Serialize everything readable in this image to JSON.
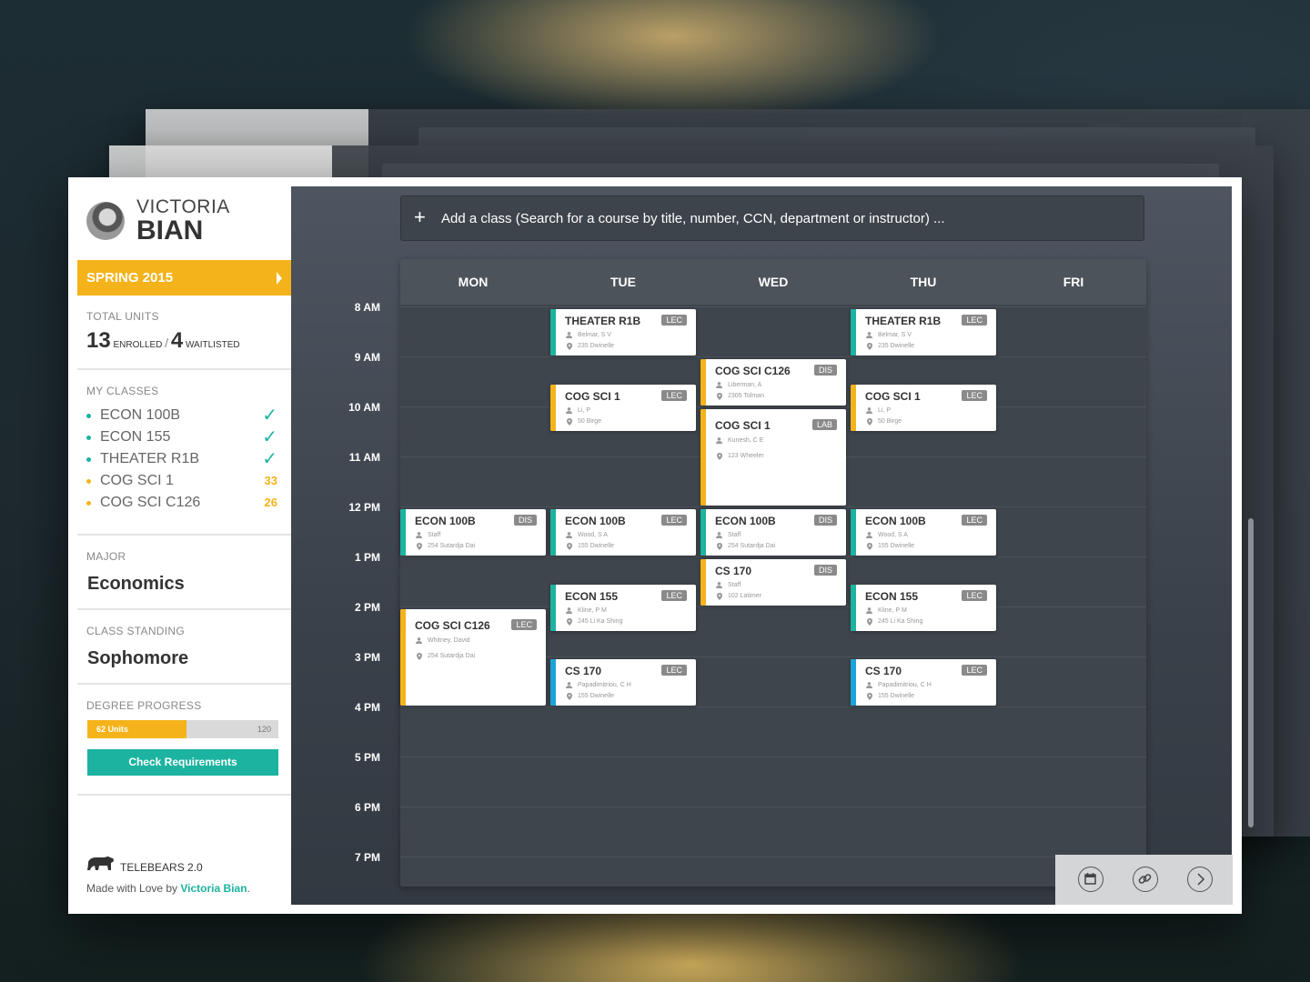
{
  "user": {
    "first_name": "VICTORIA",
    "last_name": "BIAN"
  },
  "term": {
    "label": "SPRING 2015"
  },
  "units": {
    "label": "TOTAL UNITS",
    "enrolled": "13",
    "enrolled_label": "ENROLLED",
    "sep": "/",
    "waitlisted": "4",
    "waitlisted_label": "WAITLISTED"
  },
  "my_classes": {
    "label": "MY CLASSES",
    "items": [
      {
        "name": "ECON 100B",
        "status": "✓",
        "color": "#1cb3a0"
      },
      {
        "name": "ECON 155",
        "status": "✓",
        "color": "#1cb3a0"
      },
      {
        "name": "THEATER R1B",
        "status": "✓",
        "color": "#1cb3a0"
      },
      {
        "name": "COG SCI 1",
        "status": "33",
        "color": "#f5b31b"
      },
      {
        "name": "COG SCI C126",
        "status": "26",
        "color": "#f5b31b"
      }
    ]
  },
  "major": {
    "label": "MAJOR",
    "value": "Economics"
  },
  "standing": {
    "label": "CLASS STANDING",
    "value": "Sophomore"
  },
  "progress": {
    "label": "DEGREE PROGRESS",
    "current": "62 Units",
    "total": "120",
    "fraction": 0.517,
    "button": "Check Requirements"
  },
  "footer": {
    "title": "TELEBEARS 2.0",
    "made_prefix": "Made with Love by ",
    "author": "Victoria Bian",
    "suffix": "."
  },
  "search": {
    "plus": "+",
    "placeholder": "Add a class (Search for a course by title, number, CCN, department or instructor) ..."
  },
  "days": [
    "MON",
    "TUE",
    "WED",
    "THU",
    "FRI"
  ],
  "times": [
    "8 AM",
    "9 AM",
    "10 AM",
    "11 AM",
    "12 PM",
    "1 PM",
    "2 PM",
    "3 PM",
    "4 PM",
    "5 PM",
    "6 PM",
    "7 PM"
  ],
  "colors": {
    "teal": "#1cb3a0",
    "yellow": "#f5b31b",
    "blue": "#1aa3d9"
  },
  "events": [
    {
      "title": "THEATER R1B",
      "type": "LEC",
      "instructor": "Belmar, S V",
      "location": "235 Dwinelle",
      "day": 1,
      "start": 10.0,
      "end": 11.0,
      "color": "teal"
    },
    {
      "title": "THEATER R1B",
      "type": "LEC",
      "instructor": "Belmar, S V",
      "location": "235 Dwinelle",
      "day": 3,
      "start": 10.0,
      "end": 11.0,
      "color": "teal"
    },
    {
      "title": "COG SCI 1",
      "type": "LEC",
      "instructor": "Li, P",
      "location": "50 Birge",
      "day": 1,
      "start": 11.5,
      "end": 12.5,
      "color": "yellow"
    },
    {
      "title": "COG SCI 1",
      "type": "LEC",
      "instructor": "Li, P",
      "location": "50 Birge",
      "day": 3,
      "start": 11.5,
      "end": 12.5,
      "color": "yellow"
    },
    {
      "title": "COG SCI C126",
      "type": "DIS",
      "instructor": "Liberman, A",
      "location": "2305 Tolman",
      "day": 2,
      "start": 11.0,
      "end": 12.0,
      "color": "yellow"
    },
    {
      "title": "COG SCI 1",
      "type": "LAB",
      "instructor": "Kunesh, C E",
      "location": "123 Wheeler",
      "day": 2,
      "start": 12.0,
      "end": 14.0,
      "color": "yellow"
    },
    {
      "title": "ECON 100B",
      "type": "DIS",
      "instructor": "Staff",
      "location": "254 Sutardja Dai",
      "day": 0,
      "start": 14.0,
      "end": 15.0,
      "color": "teal"
    },
    {
      "title": "ECON 100B",
      "type": "LEC",
      "instructor": "Wood, S A",
      "location": "155 Dwinelle",
      "day": 1,
      "start": 14.0,
      "end": 15.0,
      "color": "teal"
    },
    {
      "title": "ECON 100B",
      "type": "DIS",
      "instructor": "Staff",
      "location": "254 Sutardja Dai",
      "day": 2,
      "start": 14.0,
      "end": 15.0,
      "color": "teal"
    },
    {
      "title": "ECON 100B",
      "type": "LEC",
      "instructor": "Wood, S A",
      "location": "155 Dwinelle",
      "day": 3,
      "start": 14.0,
      "end": 15.0,
      "color": "teal"
    },
    {
      "title": "CS 170",
      "type": "DIS",
      "instructor": "Staff",
      "location": "102 Latimer",
      "day": 2,
      "start": 15.0,
      "end": 16.0,
      "color": "yellow"
    },
    {
      "title": "ECON 155",
      "type": "LEC",
      "instructor": "Kline, P M",
      "location": "245 Li Ka Shing",
      "day": 1,
      "start": 15.5,
      "end": 16.5,
      "color": "teal"
    },
    {
      "title": "ECON 155",
      "type": "LEC",
      "instructor": "Kline, P M",
      "location": "245 Li Ka Shing",
      "day": 3,
      "start": 15.5,
      "end": 16.5,
      "color": "teal"
    },
    {
      "title": "COG SCI C126",
      "type": "LEC",
      "instructor": "Whitney, David",
      "location": "254 Sutardja Dai",
      "day": 0,
      "start": 16.0,
      "end": 18.0,
      "color": "yellow"
    },
    {
      "title": "CS 170",
      "type": "LEC",
      "instructor": "Papadimitriou, C H",
      "location": "155 Dwinelle",
      "day": 1,
      "start": 17.0,
      "end": 18.0,
      "color": "blue"
    },
    {
      "title": "CS 170",
      "type": "LEC",
      "instructor": "Papadimitriou, C H",
      "location": "155 Dwinelle",
      "day": 3,
      "start": 17.0,
      "end": 18.0,
      "color": "blue"
    }
  ],
  "tools": [
    "calendar-icon",
    "link-icon",
    "next-icon"
  ]
}
